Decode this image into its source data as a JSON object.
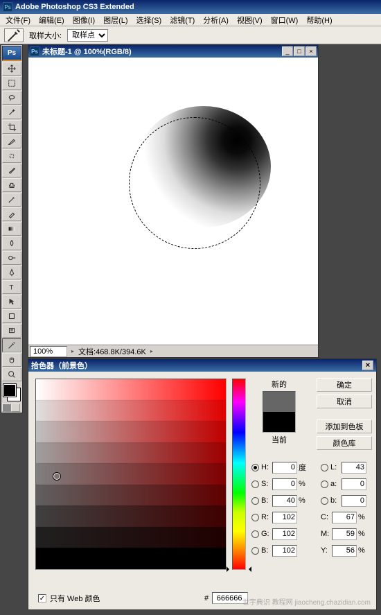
{
  "app": {
    "title": "Adobe Photoshop CS3 Extended"
  },
  "menu": {
    "file": "文件(F)",
    "edit": "编辑(E)",
    "image": "图像(I)",
    "layer": "图层(L)",
    "select": "选择(S)",
    "filter": "滤镜(T)",
    "analysis": "分析(A)",
    "view": "视图(V)",
    "window": "窗口(W)",
    "help": "帮助(H)"
  },
  "options": {
    "sample_size_label": "取样大小:",
    "sample_size_value": "取样点"
  },
  "toolbox": {
    "badge": "Ps"
  },
  "document": {
    "title": "未标题-1 @ 100%(RGB/8)",
    "zoom": "100%",
    "status": "文档:468.8K/394.6K"
  },
  "colorpicker": {
    "title": "拾色器（前景色）",
    "new_label": "新的",
    "current_label": "当前",
    "buttons": {
      "ok": "确定",
      "cancel": "取消",
      "add_swatch": "添加到色板",
      "libraries": "颜色库"
    },
    "hsb": {
      "h_label": "H:",
      "h": "0",
      "h_unit": "度",
      "s_label": "S:",
      "s": "0",
      "s_unit": "%",
      "b_label": "B:",
      "b": "40",
      "b_unit": "%"
    },
    "lab": {
      "l_label": "L:",
      "l": "43",
      "a_label": "a:",
      "a": "0",
      "bb_label": "b:",
      "bb": "0"
    },
    "rgb": {
      "r_label": "R:",
      "r": "102",
      "g_label": "G:",
      "g": "102",
      "b_label": "B:",
      "b": "102"
    },
    "cmyk": {
      "c_label": "C:",
      "c": "67",
      "c_unit": "%",
      "m_label": "M:",
      "m": "59",
      "m_unit": "%",
      "y_label": "Y:",
      "y": "56",
      "y_unit": "%"
    },
    "web_only_label": "只有 Web 颜色",
    "hex_label": "#",
    "hex": "666666"
  },
  "watermark": "世宇典识 教程网\njiaocheng.chazidian.com"
}
